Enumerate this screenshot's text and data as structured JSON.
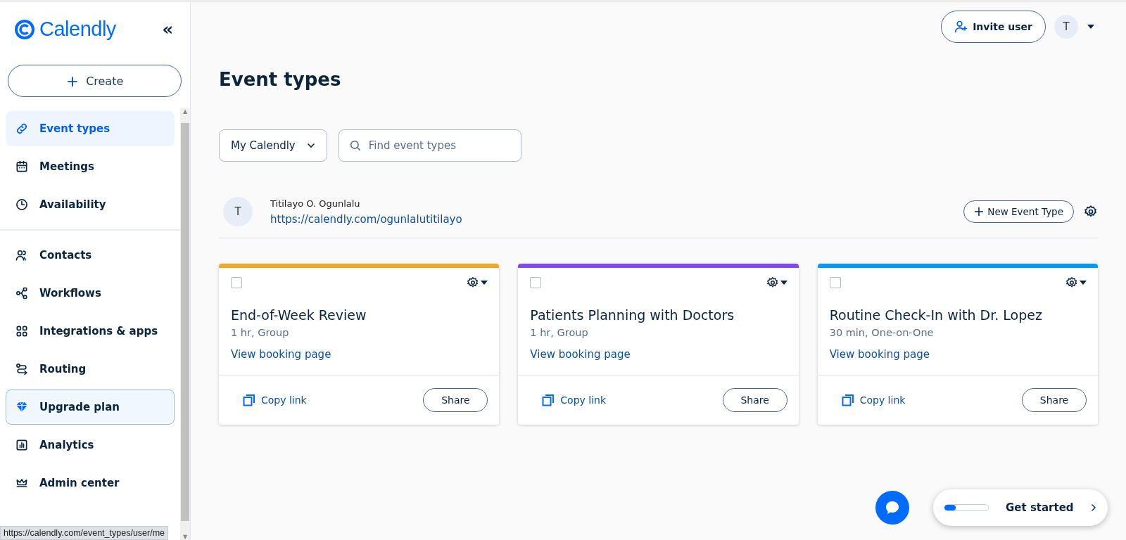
{
  "brand": {
    "name": "Calendly"
  },
  "sidebar": {
    "collapse": "«",
    "create": {
      "icon": "+",
      "label": "Create"
    },
    "groups": [
      {
        "items": [
          {
            "label": "Event types",
            "selected": true,
            "kind": "link"
          },
          {
            "label": "Meetings",
            "selected": false,
            "kind": "link"
          },
          {
            "label": "Availability",
            "selected": false,
            "kind": "link"
          }
        ]
      },
      {
        "items": [
          {
            "label": "Contacts",
            "selected": false,
            "kind": "link"
          },
          {
            "label": "Workflows",
            "selected": false,
            "kind": "link"
          },
          {
            "label": "Integrations & apps",
            "selected": false,
            "kind": "link"
          },
          {
            "label": "Routing",
            "selected": false,
            "kind": "link"
          },
          {
            "label": "Upgrade plan",
            "selected": false,
            "kind": "upgrade"
          },
          {
            "label": "Analytics",
            "selected": false,
            "kind": "link"
          },
          {
            "label": "Admin center",
            "selected": false,
            "kind": "link"
          }
        ]
      }
    ]
  },
  "scrollbar": {
    "up": "▲",
    "down": "▼"
  },
  "status_bar": {
    "url": "https://calendly.com/event_types/user/me"
  },
  "header": {
    "invite": "Invite user",
    "avatar": "T"
  },
  "page": {
    "title": "Event types",
    "filter": "My Calendly",
    "search": {
      "placeholder": "Find event types"
    }
  },
  "user": {
    "avatar": "T",
    "name": "Titilayo O. Ogunlalu",
    "url": "https://calendly.com/ogunlalutitilayo",
    "new_event": "New Event Type"
  },
  "cards": [
    {
      "color": "#f5a623",
      "checked": false,
      "title": "End-of-Week Review",
      "details": "1 hr, Group",
      "link": "View booking page",
      "copy": "Copy link",
      "share": "Share"
    },
    {
      "color": "#8247f5",
      "checked": false,
      "title": "Patients Planning with Doctors",
      "details": "1 hr, Group",
      "link": "View booking page",
      "copy": "Copy link",
      "share": "Share"
    },
    {
      "color": "#0099ff",
      "checked": false,
      "title": "Routine Check-In with Dr. Lopez",
      "details": "30 min, One-on-One",
      "link": "View booking page",
      "copy": "Copy link",
      "share": "Share"
    }
  ],
  "get_started": {
    "label": "Get started",
    "level": 0.25
  }
}
